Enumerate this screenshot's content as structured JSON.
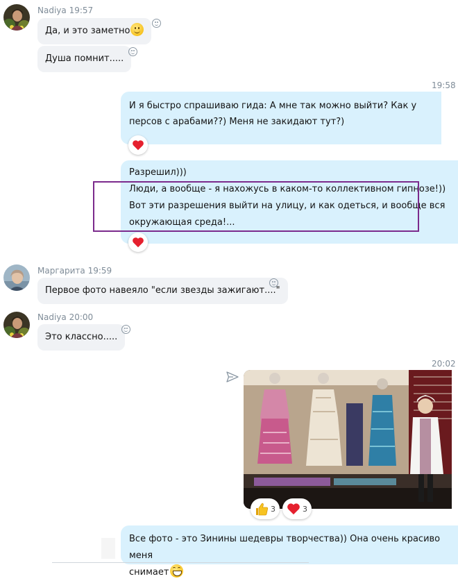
{
  "messages": [
    {
      "sender": "Nadiya",
      "time": "19:57"
    },
    {
      "text": "Да, и это заметно"
    },
    {
      "text": "Душа помнит....."
    },
    {
      "time": "19:58"
    },
    {
      "text": "И я быстро спрашиваю гида: А мне так можно выйти? Как у персов с арабами??) Меня не закидают тут?)"
    },
    {
      "line1": "Разрешил)))",
      "line2": "Люди, а вообще - я нахожусь в каком-то коллективном гипнозе!))",
      "line3": "Вот эти разрешения выйти на улицу, и как одеться, и вообще вся",
      "line4": "окружающая среда!..."
    },
    {
      "sender": "Маргарита",
      "time": "19:59"
    },
    {
      "text": "Первое фото навеяло \"если звезды зажигают....\""
    },
    {
      "sender": "Nadiya",
      "time": "20:00"
    },
    {
      "text": "Это классно....."
    },
    {
      "time": "20:02",
      "reactions": [
        {
          "icon": "thumbs-up-icon",
          "count": "3"
        },
        {
          "icon": "heart-icon",
          "count": "3"
        }
      ]
    },
    {
      "line1": "Все фото - это Зинины шедевры творчества)) Она очень красиво меня",
      "line2": "снимает"
    }
  ],
  "colors": {
    "incoming_bubble": "#f0f2f5",
    "outgoing_bubble": "#d9f1fd",
    "highlight_box": "#7b2a8c",
    "heart": "#e5202e",
    "meta_text": "#7f8c98"
  }
}
